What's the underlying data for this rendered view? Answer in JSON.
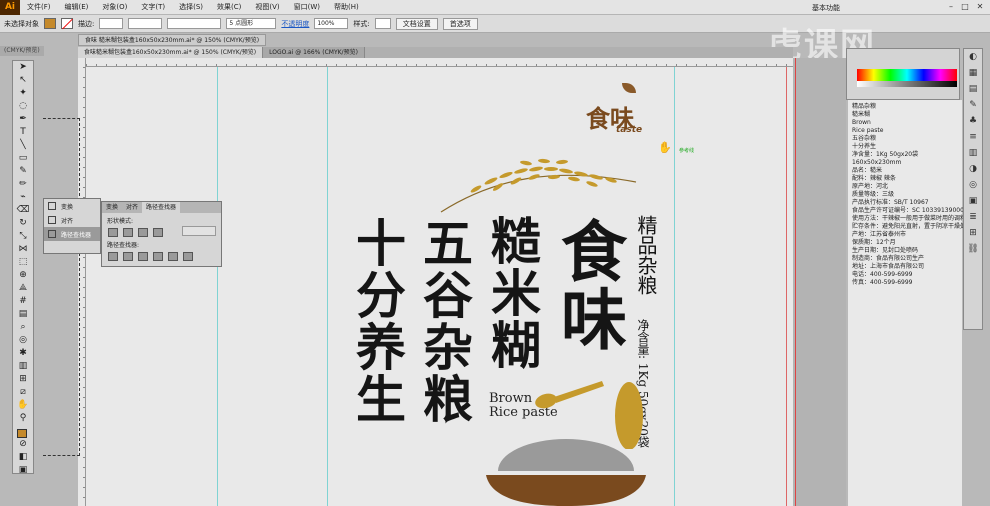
{
  "app": {
    "logo": "Ai"
  },
  "menubar": {
    "items": [
      "文件(F)",
      "编辑(E)",
      "对象(O)",
      "文字(T)",
      "选择(S)",
      "效果(C)",
      "视图(V)",
      "窗口(W)",
      "帮助(H)"
    ],
    "workspace": "基本功能"
  },
  "controlbar": {
    "selection": "未选择对象",
    "stroke_label": "描边:",
    "brush": "5 点圆形",
    "opacity_link": "不透明度",
    "opacity_value": "100%",
    "style_label": "样式:",
    "doc_setup": "文档设置",
    "preferences": "首选项"
  },
  "tabs": {
    "floating": "食味 糙米糊包装盒160x50x230mm.ai* @ 150% (CMYK/预览)",
    "background": "(CMYK/预览)",
    "docs": [
      "食味糙米糊包装盒160x50x230mm.ai* @ 150% (CMYK/预览)",
      "LOGO.ai @ 166% (CMYK/预览)"
    ]
  },
  "pathfinder": {
    "list": [
      "变换",
      "对齐",
      "路径查找器"
    ],
    "tabs": [
      "变换",
      "对齐",
      "路径查找器"
    ],
    "shape_modes": "形状模式:",
    "pathfinders": "路径查找器:"
  },
  "design": {
    "title_1": "十分养生",
    "title_2": "五谷杂粮",
    "title_3": "糙米糊",
    "title_4": "食味",
    "subtitle": "精品杂粮",
    "net_weight": "净含量: 1Kg 50gx20袋",
    "brown": "Brown",
    "rice_paste": "Rice paste",
    "logo": "食味",
    "logo_sub": "taste",
    "slice_label": "参考线",
    "colors": {
      "brown": "#7a4a1e",
      "gold": "#c59a2c",
      "bowl_gray": "#9a9a9a"
    }
  },
  "info": {
    "lines": [
      "精品杂粮",
      "",
      "糙米糊",
      "Brown",
      "Rice paste",
      "",
      "五谷杂粮",
      "十分养生",
      "",
      "净含量：1Kg 50gx20袋",
      "",
      "160x50x230mm",
      "",
      "",
      "",
      "品名：糙米",
      "配料：辣椒 辣条",
      "原产地：河北",
      "质量等级：三级",
      "产品执行标准：SB/T 10967",
      "食品生产许可证编号：SC 10339139000596",
      "使用方法：干辣椒一般用于做菜时用的调料",
      "贮存条件：避免阳光直射，置于阴凉干燥处。",
      "产地：江苏省泰州市",
      "保质期：12个月",
      "生产日期：见封口处喷码",
      "制造商：食品有限公司生产",
      "地址：上海市食品有限公司",
      "电话：400-599-6999",
      "传真：400-599-6999"
    ]
  },
  "watermark": "虎课网"
}
